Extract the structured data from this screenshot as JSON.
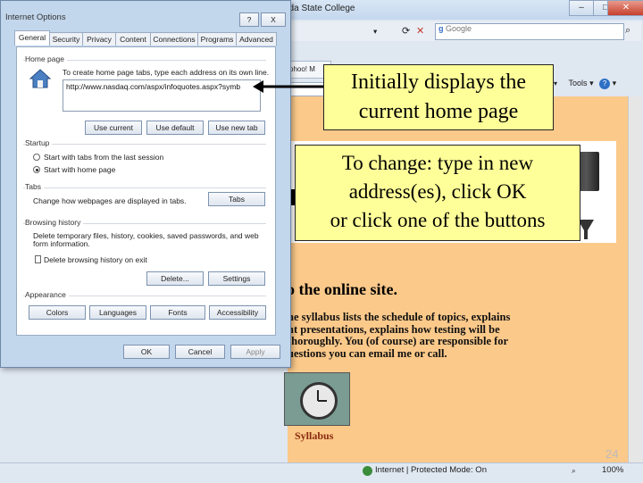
{
  "browser": {
    "title": "rida State College",
    "search_placeholder": "Google",
    "page_tab_label": "ohoo! M",
    "tools_label": "Tools",
    "help_icon": "help-icon",
    "page_content": {
      "welcome_heading": "o the online site.",
      "intro_lines": [
        "he syllabus lists the schedule of topics, explains",
        "nt presentations, explains how testing will be",
        "thoroughly.  You (of course) are responsible for",
        "uestions you can email me or call."
      ],
      "syllabus_label": "Syllabus"
    },
    "status_text": "Internet | Protected Mode: On",
    "zoom_text": "100%"
  },
  "dialog": {
    "title": "Internet Options",
    "help_symbol": "?",
    "close_symbol": "X",
    "tabs": [
      "General",
      "Security",
      "Privacy",
      "Content",
      "Connections",
      "Programs",
      "Advanced"
    ],
    "home_page": {
      "group_label": "Home page",
      "instruction": "To create home page tabs, type each address on its own line.",
      "url": "http://www.nasdaq.com/aspx/infoquotes.aspx?symb",
      "buttons": [
        "Use current",
        "Use default",
        "Use new tab"
      ]
    },
    "startup": {
      "group_label": "Startup",
      "options": [
        "Start with tabs from the last session",
        "Start with home page"
      ],
      "selected_index": 1
    },
    "tabs_group": {
      "group_label": "Tabs",
      "text": "Change how webpages are displayed in tabs.",
      "button": "Tabs"
    },
    "browsing_history": {
      "group_label": "Browsing history",
      "text_line1": "Delete temporary files, history, cookies, saved passwords, and web",
      "text_line2": "form information.",
      "checkbox_label": "Delete browsing history on exit",
      "checkbox_checked": false,
      "buttons": [
        "Delete...",
        "Settings"
      ]
    },
    "appearance": {
      "group_label": "Appearance",
      "buttons": [
        "Colors",
        "Languages",
        "Fonts",
        "Accessibility"
      ]
    },
    "footer_buttons": [
      "OK",
      "Cancel",
      "Apply"
    ]
  },
  "callouts": {
    "first": [
      "Initially displays the",
      "current home page"
    ],
    "second": [
      "To change: type in new",
      "address(es), click OK",
      "or click one of the buttons"
    ]
  },
  "slide_number": "24",
  "colors": {
    "callout_bg": "#ffff99",
    "page_bg": "#fbc98a",
    "dialog_chrome": "#c2d6ec"
  }
}
